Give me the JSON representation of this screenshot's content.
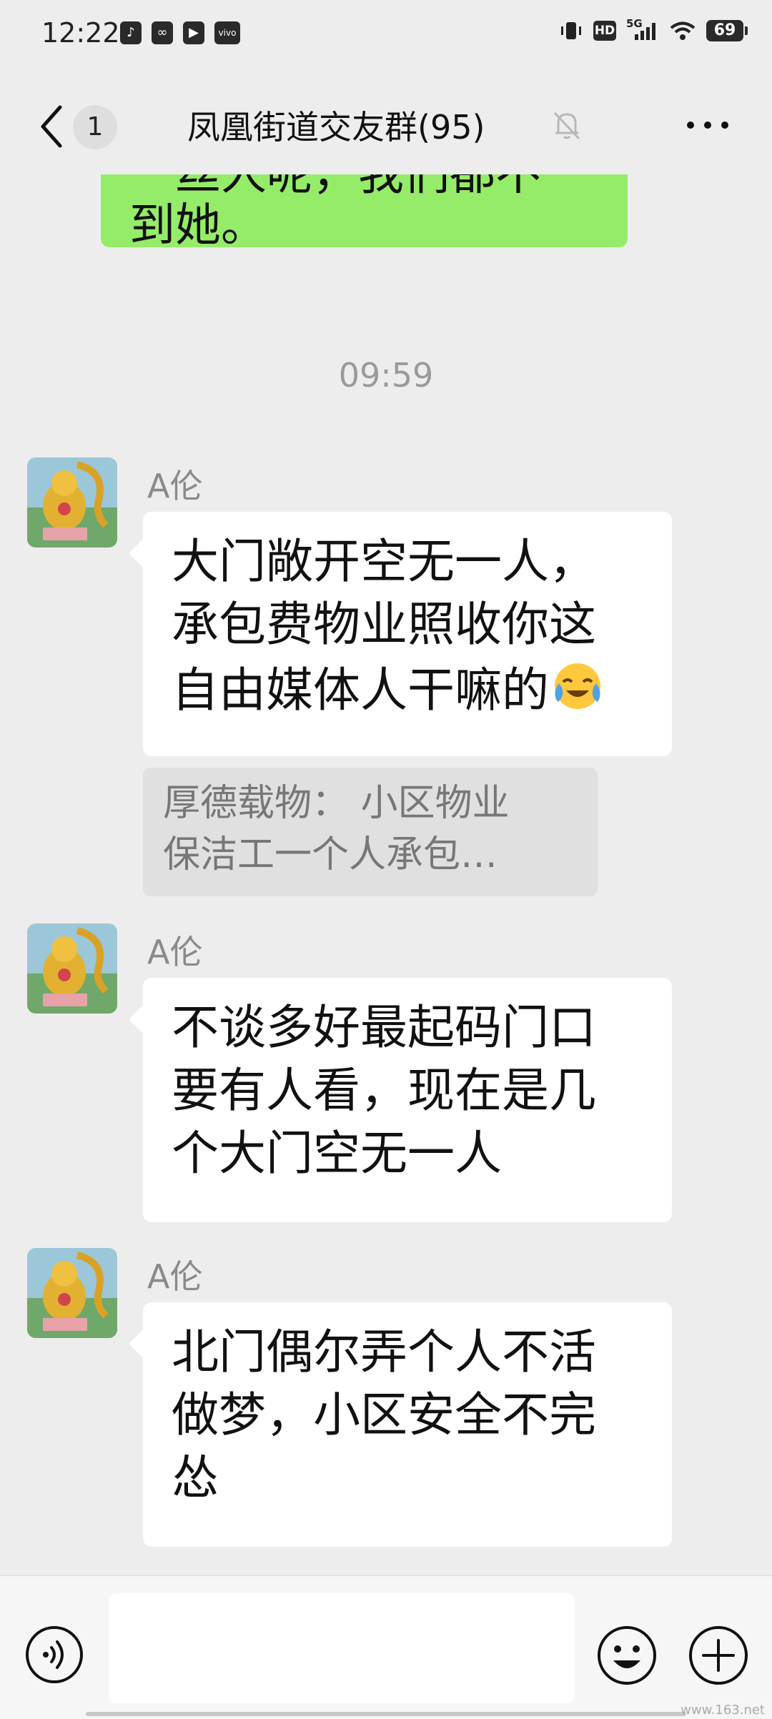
{
  "status_bar": {
    "time": "12:22",
    "app_icons": [
      "tiktok-icon",
      "link-icon",
      "play-icon",
      "vivo-icon"
    ],
    "hd": "HD",
    "network": "5G",
    "battery": "69"
  },
  "nav": {
    "unread_count": "1",
    "title": "凤凰街道交友群(95)"
  },
  "messages": {
    "sent_partial": {
      "line1": "一丝人呢，我们都不",
      "line2": "到她。"
    },
    "timestamp": "09:59",
    "items": [
      {
        "sender": "A伦",
        "lines": [
          "大门敞开空无一人，",
          "承包费物业照收你这",
          "自由媒体人干嘛的"
        ],
        "emoji": "crying-laughing-emoji",
        "quote": [
          "厚德载物：  小区物业",
          "保洁工一个人承包…"
        ]
      },
      {
        "sender": "A伦",
        "lines": [
          "不谈多好最起码门口",
          "要有人看，现在是几",
          "个大门空无一人"
        ]
      },
      {
        "sender": "A伦",
        "lines": [
          "北门偶尔弄个人不活",
          "做梦，小区安全不完",
          "怂"
        ]
      }
    ]
  },
  "input": {
    "value": "",
    "placeholder": ""
  },
  "watermark": "www.163.net",
  "colors": {
    "background": "#ededed",
    "sent_bubble": "#95ec69",
    "received_bubble": "#ffffff",
    "quote_background": "#e0e0e0"
  }
}
